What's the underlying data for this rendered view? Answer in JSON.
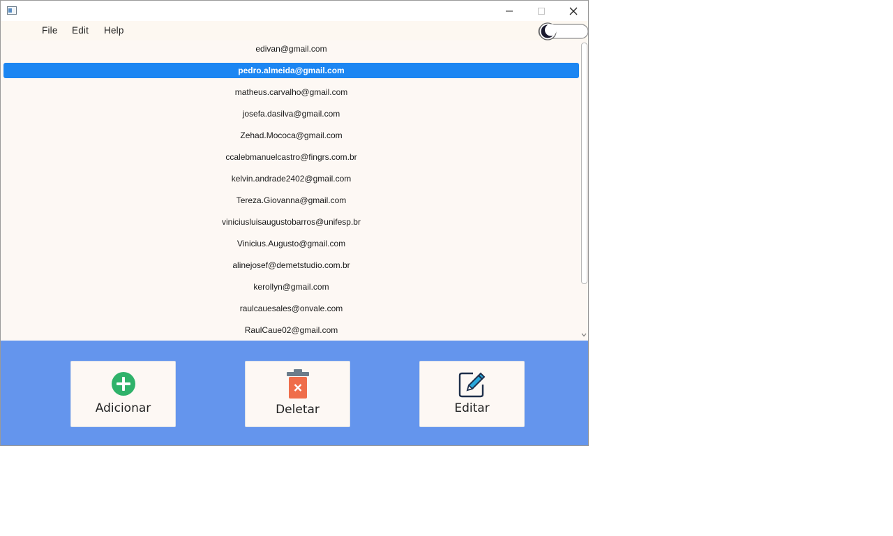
{
  "window": {
    "icon": "app-window-icon",
    "controls": [
      "minimize-icon",
      "maximize-icon",
      "close-icon"
    ]
  },
  "menubar": {
    "items": [
      "File",
      "Edit",
      "Help"
    ],
    "theme_toggle_icon": "moon-icon"
  },
  "email_list": {
    "selected_index": 1,
    "items": [
      "edivan@gmail.com",
      "pedro.almeida@gmail.com",
      "matheus.carvalho@gmail.com",
      "josefa.dasilva@gmail.com",
      "Zehad.Mococa@gmail.com",
      "ccalebmanuelcastro@fingrs.com.br",
      "kelvin.andrade2402@gmail.com",
      "Tereza.Giovanna@gmail.com",
      "viniciusluisaugustobarros@unifesp.br",
      "Vinicius.Augusto@gmail.com",
      "alinejosef@demetstudio.com.br",
      "kerollyn@gmail.com",
      "raulcauesales@onvale.com",
      "RaulCaue02@gmail.com"
    ]
  },
  "actions": {
    "add": {
      "label": "Adicionar",
      "icon": "plus-circle-icon"
    },
    "delete": {
      "label": "Deletar",
      "icon": "trash-icon"
    },
    "edit": {
      "label": "Editar",
      "icon": "edit-icon"
    }
  },
  "colors": {
    "selection": "#1c86f2",
    "action_bar": "#6495ed",
    "add_icon": "#2fb26a",
    "delete_icon": "#ef6d4a",
    "edit_icon": "#2aa8dc"
  }
}
